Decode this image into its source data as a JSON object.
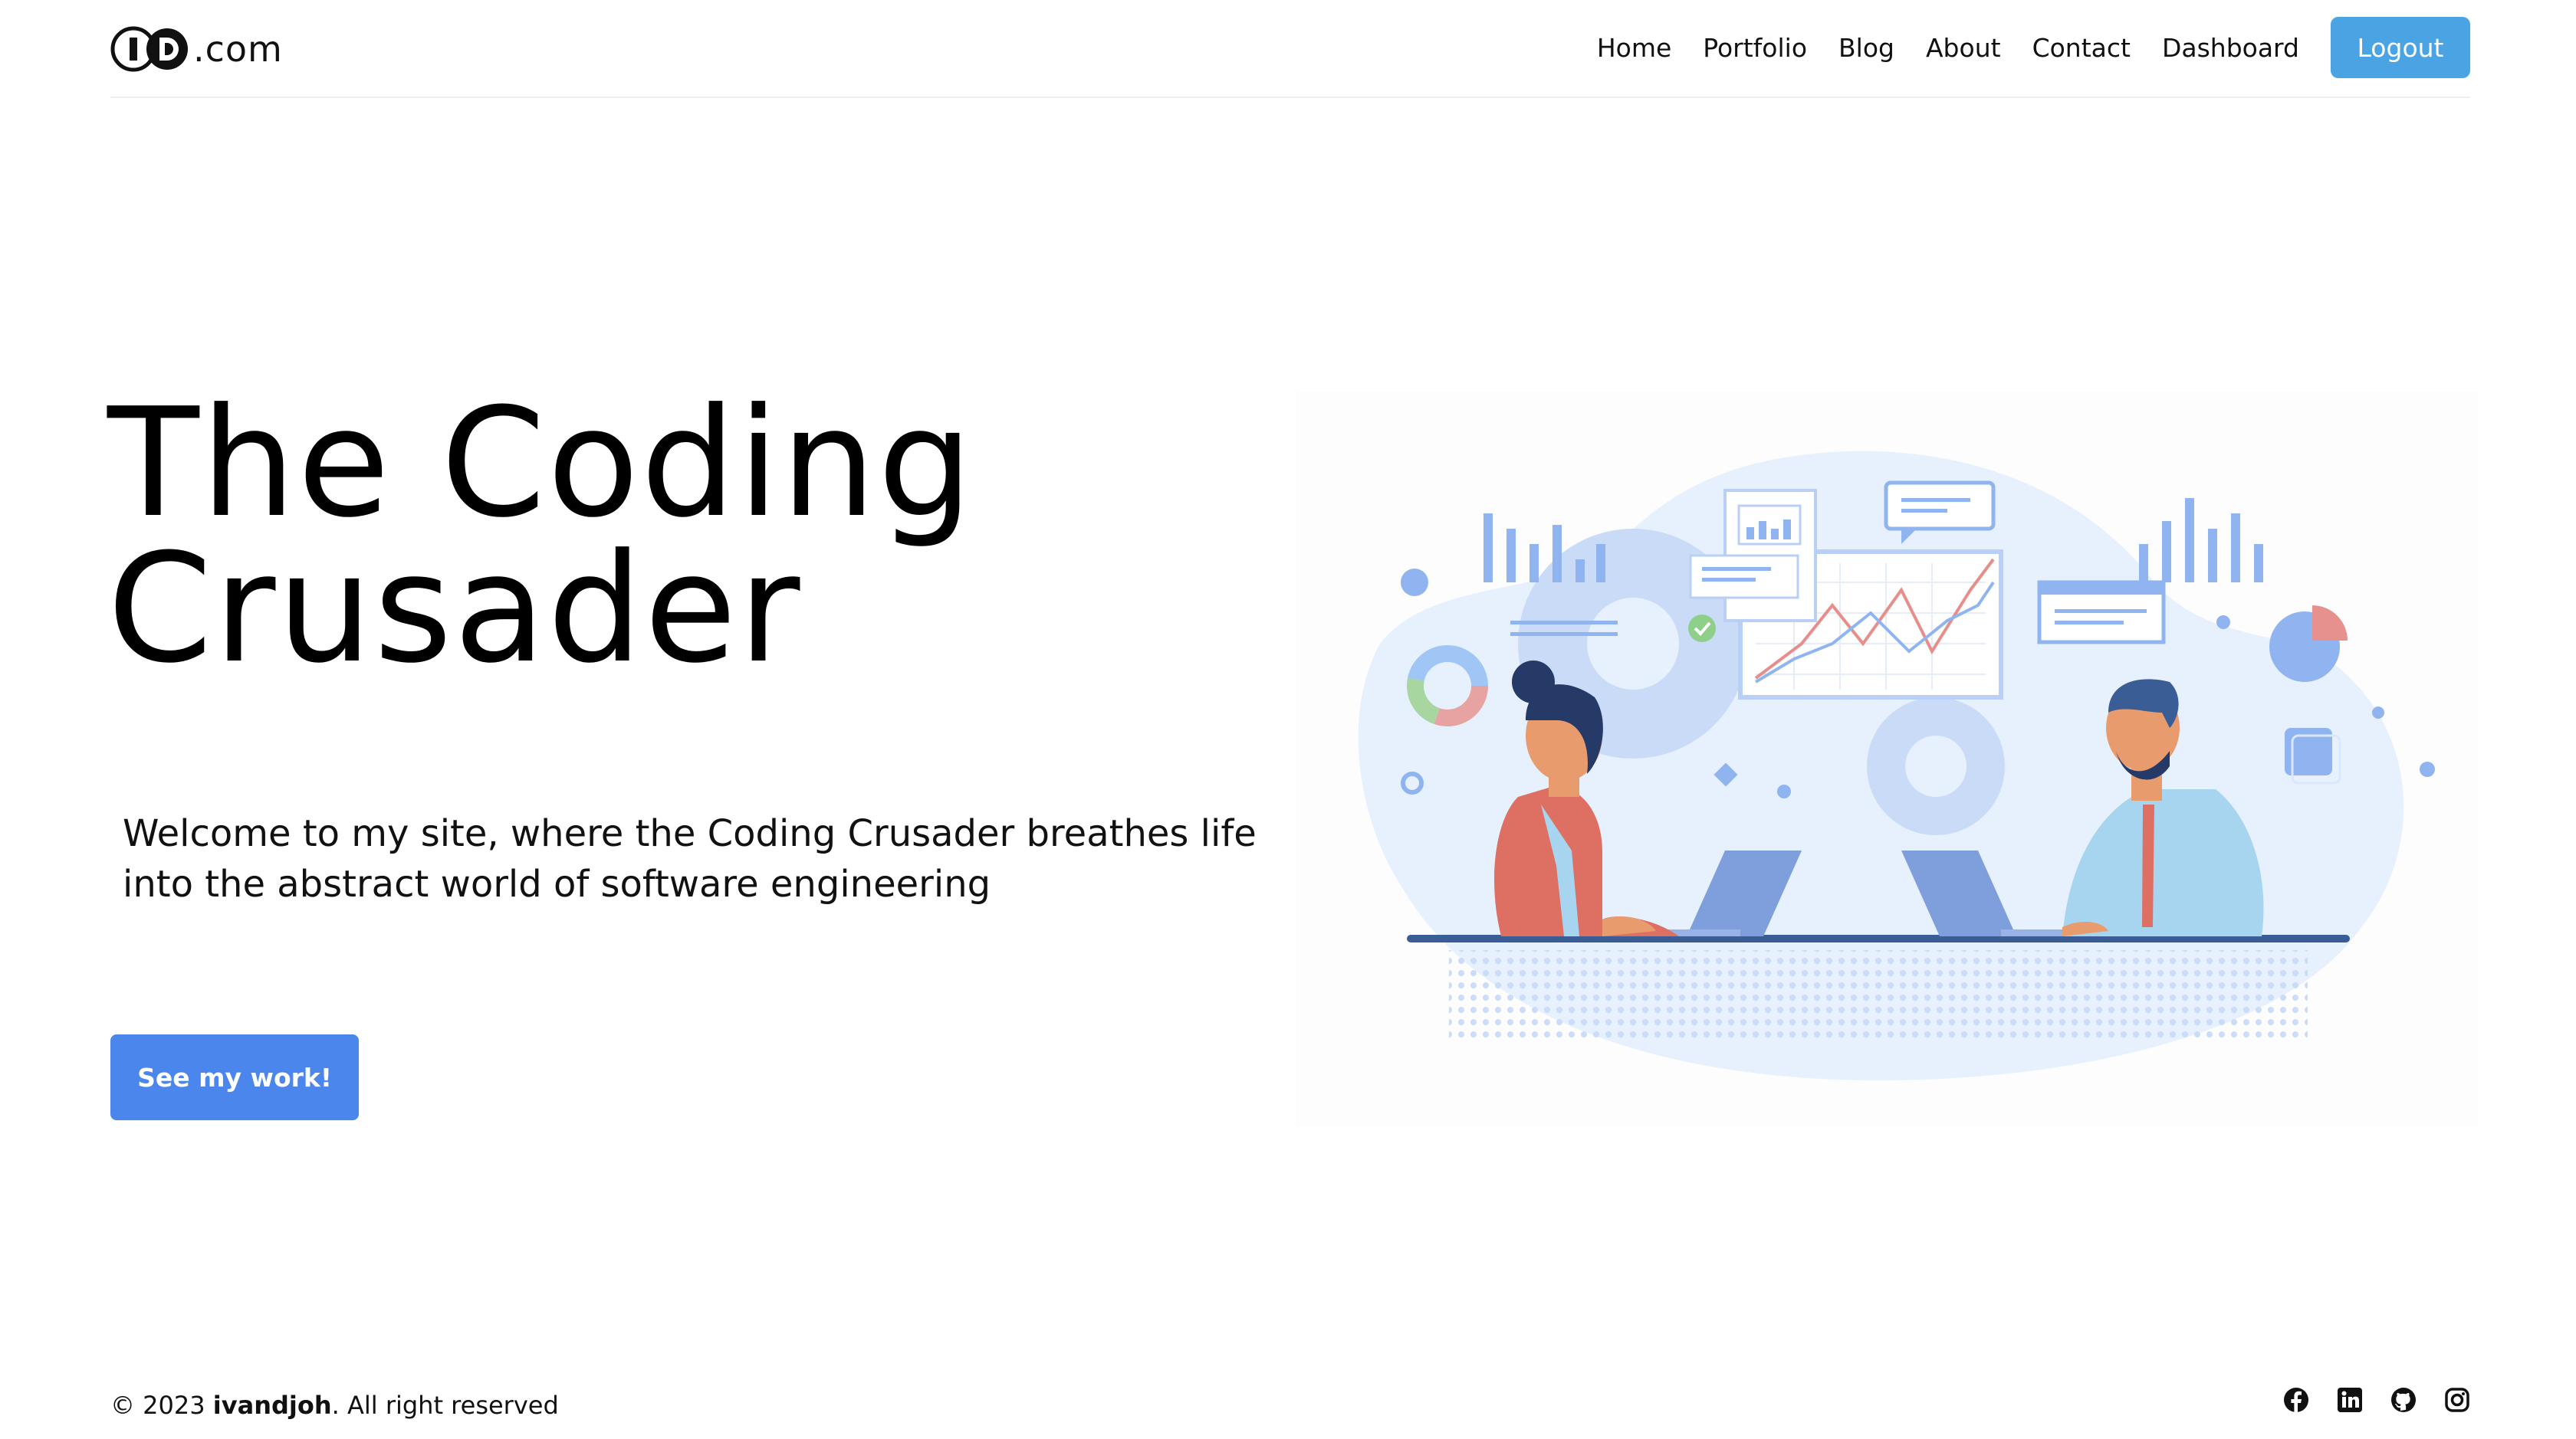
{
  "header": {
    "logo_letters": "ID",
    "logo_suffix": ".com",
    "nav": [
      {
        "label": "Home"
      },
      {
        "label": "Portfolio"
      },
      {
        "label": "Blog"
      },
      {
        "label": "About"
      },
      {
        "label": "Contact"
      },
      {
        "label": "Dashboard"
      }
    ],
    "logout_label": "Logout"
  },
  "hero": {
    "title_line1": "The Coding",
    "title_line2": "Crusader",
    "subtitle": "Welcome to my site, where the Coding Crusader breathes life into the abstract world of software engineering",
    "cta_label": "See my work!"
  },
  "footer": {
    "copyright_prefix": "© 2023",
    "owner": "ivandjoh",
    "copyright_suffix": ". All right reserved",
    "socials": [
      "facebook-icon",
      "linkedin-icon",
      "github-icon",
      "instagram-icon"
    ]
  },
  "colors": {
    "logout_button": "#4aa3e3",
    "cta_button": "#4a86eb",
    "illustration_blob": "#e7f1fd",
    "illustration_blue": "#8fb4f0"
  }
}
